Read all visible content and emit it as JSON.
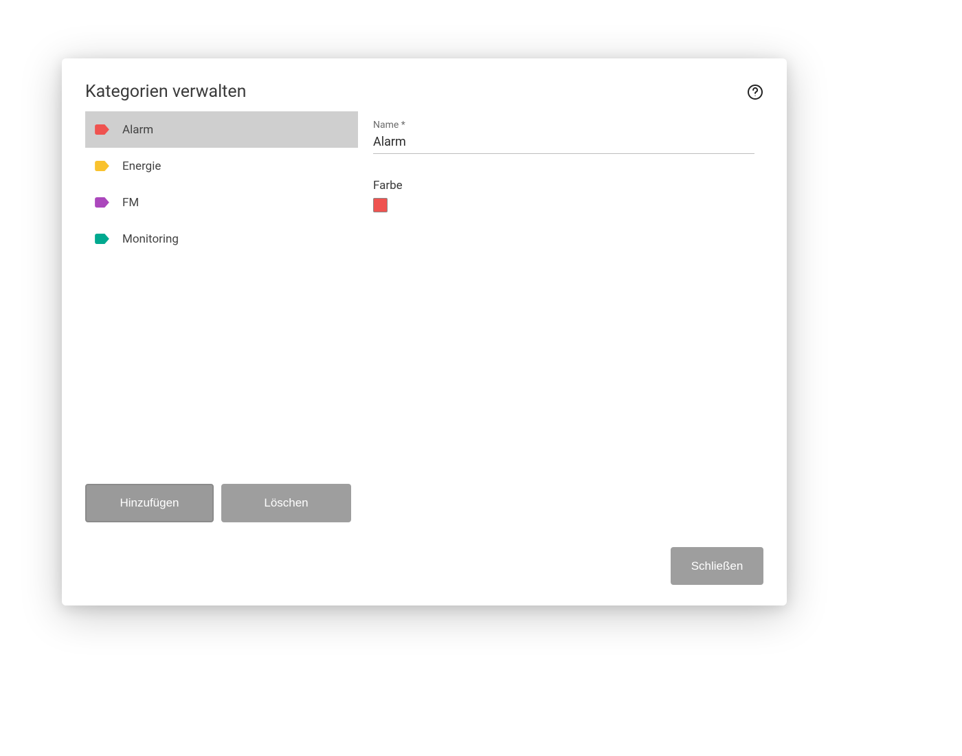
{
  "dialog": {
    "title": "Kategorien verwalten"
  },
  "categories": [
    {
      "label": "Alarm",
      "color": "#ef5350",
      "selected": true
    },
    {
      "label": "Energie",
      "color": "#f9c22e",
      "selected": false
    },
    {
      "label": "FM",
      "color": "#ab47bc",
      "selected": false
    },
    {
      "label": "Monitoring",
      "color": "#00a98f",
      "selected": false
    }
  ],
  "form": {
    "name_label": "Name *",
    "name_value": "Alarm",
    "color_label": "Farbe",
    "color_value": "#ef5350"
  },
  "buttons": {
    "add": "Hinzufügen",
    "delete": "Löschen",
    "close": "Schließen"
  }
}
